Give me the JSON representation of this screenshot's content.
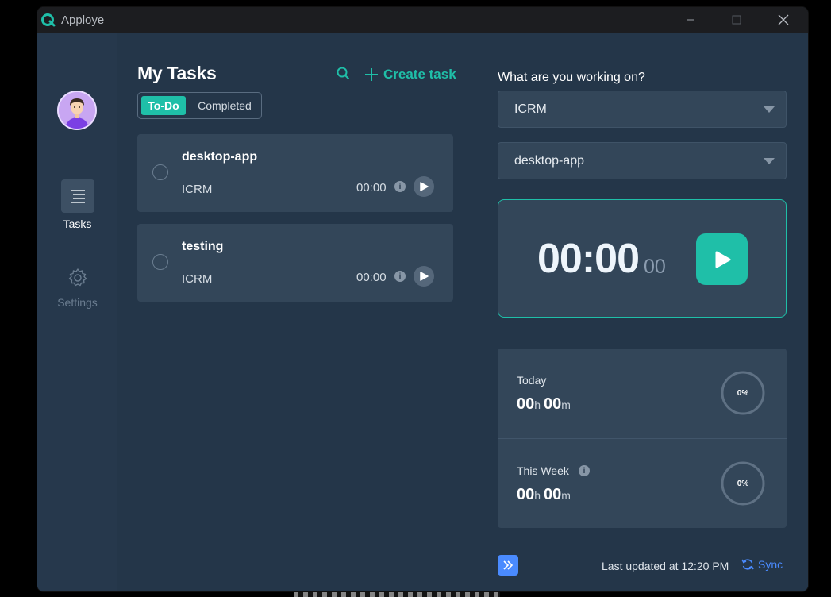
{
  "app": {
    "title": "Apploye"
  },
  "sidebar": {
    "items": [
      {
        "label": "Tasks",
        "icon": "tasks-icon",
        "active": true
      },
      {
        "label": "Settings",
        "icon": "gear-icon",
        "active": false
      }
    ]
  },
  "tasks": {
    "title": "My Tasks",
    "create_label": "Create task",
    "tabs": [
      {
        "label": "To-Do",
        "active": true
      },
      {
        "label": "Completed",
        "active": false
      }
    ],
    "items": [
      {
        "name": "desktop-app",
        "project": "ICRM",
        "time": "00:00"
      },
      {
        "name": "testing",
        "project": "ICRM",
        "time": "00:00"
      }
    ]
  },
  "tracker": {
    "question": "What are you working on?",
    "project_select": "ICRM",
    "task_select": "desktop-app",
    "timer_main": "00:00",
    "timer_seconds": "00"
  },
  "stats": {
    "today": {
      "label": "Today",
      "hours": "00",
      "minutes": "00",
      "percent": "0%",
      "progress": 0
    },
    "week": {
      "label": "This Week",
      "hours": "00",
      "minutes": "00",
      "percent": "0%",
      "progress": 0
    },
    "hour_unit": "h",
    "minute_unit": "m"
  },
  "footer": {
    "last_updated": "Last updated at 12:20 PM",
    "sync_label": "Sync"
  },
  "colors": {
    "accent": "#1fbfa8",
    "link": "#4a8bff",
    "background": "#243649",
    "card": "#334659"
  }
}
